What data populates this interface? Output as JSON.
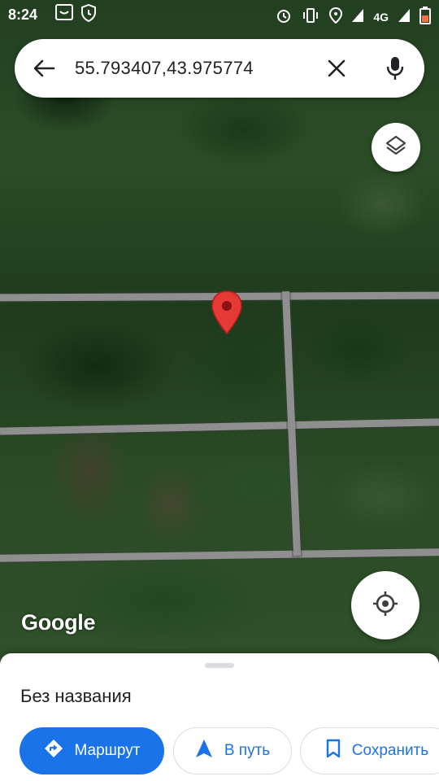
{
  "status_bar": {
    "time": "8:24",
    "network": "4G",
    "icons_left": [
      "smile-box-icon",
      "shield-icon"
    ],
    "icons_right": [
      "alarm-icon",
      "vibrate-icon",
      "location-icon",
      "signal-icon",
      "signal-icon",
      "battery-icon"
    ]
  },
  "search": {
    "query": "55.793407,43.975774",
    "back_icon": "arrow-back-icon",
    "clear_icon": "close-icon",
    "mic_icon": "mic-icon"
  },
  "map": {
    "brand": "Google",
    "layers_icon": "layers-icon",
    "locate_icon": "my-location-icon",
    "pin_color": "#e53935"
  },
  "place": {
    "title": "Без названия"
  },
  "actions": {
    "route_label": "Маршрут",
    "go_label": "В путь",
    "save_label": "Сохранить"
  },
  "colors": {
    "accent": "#1a73e8",
    "text": "#202124"
  }
}
